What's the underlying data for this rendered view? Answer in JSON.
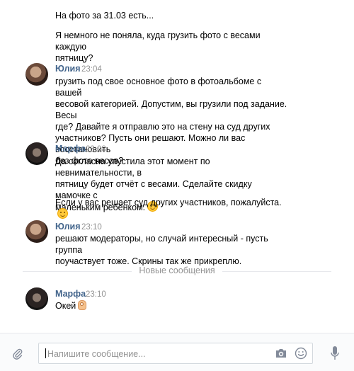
{
  "messages": [
    {
      "text_lines": [
        "На фото за 31.03 есть..."
      ]
    },
    {
      "text_lines": [
        "Я немного не поняла, куда грузить фото с весами каждую",
        "пятницу?"
      ]
    },
    {
      "author": "Юлия",
      "time": "23:04",
      "text_lines": [
        "грузить под свое основное фото в фотоальбоме с вашей",
        "весовой категорией. Допустим, вы грузили под задание. Весы",
        "где? Давайте я отправлю это на стену на суд других",
        "участников? Пусть они решают. Можно ли вас восстановить",
        "без фото весов?"
      ]
    },
    {
      "author": "Марфа",
      "time": "23:08",
      "text_lines": [
        "Да согласна упустила этот момент по невнимательности, в",
        "пятницу будет отчёт с весами. Сделайте скидку мамочке с",
        "маленьким ребёнком."
      ],
      "followup": "Если у вас решает суд других участников, пожалуйста."
    },
    {
      "author": "Юлия",
      "time": "23:10",
      "text_lines": [
        "решают модераторы, но случай интересный - пусть группа",
        "поучаствует тоже. Скрины так же прикреплю."
      ]
    },
    {
      "author": "Марфа",
      "time": "23:10",
      "text_lines": [
        "Окей"
      ]
    }
  ],
  "divider_label": "Новые сообщения",
  "composer": {
    "placeholder": "Напишите сообщение..."
  },
  "icons": {
    "attach": "paperclip-icon",
    "camera": "camera-icon",
    "emoji": "smile-icon",
    "mic": "microphone-icon"
  },
  "colors": {
    "author": "#42648b",
    "time": "#939393",
    "accent": "#5181b8"
  }
}
